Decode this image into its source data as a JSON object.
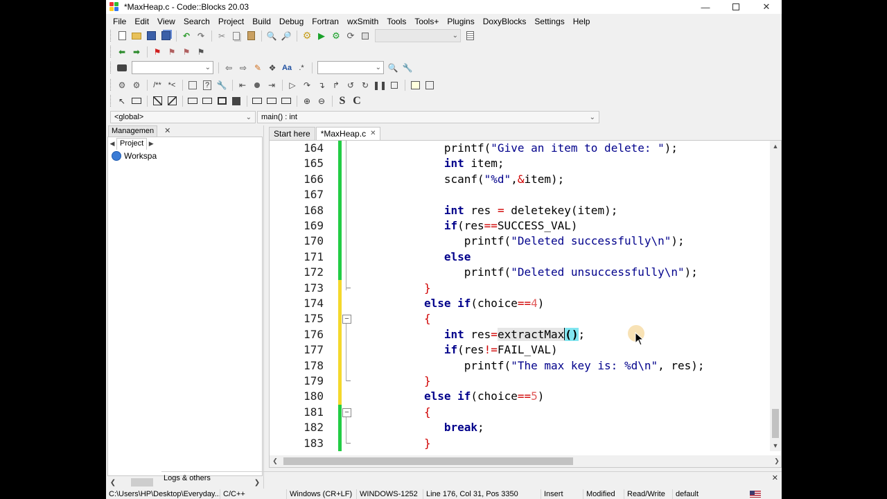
{
  "window": {
    "title": "*MaxHeap.c - Code::Blocks 20.03"
  },
  "menu": [
    "File",
    "Edit",
    "View",
    "Search",
    "Project",
    "Build",
    "Debug",
    "Fortran",
    "wxSmith",
    "Tools",
    "Tools+",
    "Plugins",
    "DoxyBlocks",
    "Settings",
    "Help"
  ],
  "scope": {
    "global": "<global>",
    "function": "main() : int"
  },
  "management": {
    "title": "Managemen",
    "projects_tab": "Project",
    "workspace": "Workspa"
  },
  "editor": {
    "tabs": [
      {
        "label": "Start here",
        "active": false
      },
      {
        "label": "*MaxHeap.c",
        "active": true
      }
    ],
    "line_numbers": [
      "164",
      "165",
      "166",
      "167",
      "168",
      "169",
      "170",
      "171",
      "172",
      "173",
      "174",
      "175",
      "176",
      "177",
      "178",
      "179",
      "180",
      "181",
      "182",
      "183"
    ]
  },
  "logs": {
    "label": "Logs & others"
  },
  "status": {
    "path": "C:\\Users\\HP\\Desktop\\Everyday...",
    "language": "C/C++",
    "eol": "Windows (CR+LF)",
    "encoding": "WINDOWS-1252",
    "position": "Line 176, Col 31, Pos 3350",
    "mode": "Insert",
    "modified": "Modified",
    "access": "Read/Write",
    "profile": "default"
  },
  "colors": {
    "keyword": "#00008b",
    "string": "#00008b",
    "operator": "#d00000",
    "number": "#e05a5a",
    "changebar_saved": "#22cc44",
    "changebar_modified": "#f4d82c",
    "brace_match": "#82e6f0"
  }
}
